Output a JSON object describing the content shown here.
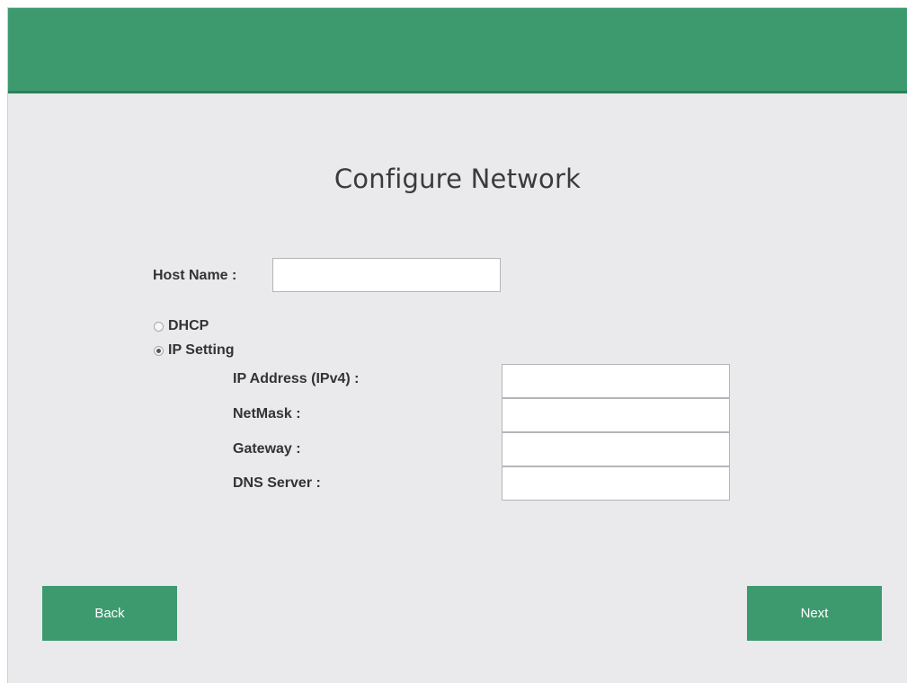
{
  "page": {
    "title": "Configure Network"
  },
  "form": {
    "host_name_label": "Host Name :",
    "host_name_value": "",
    "network_mode": {
      "options": [
        {
          "label": "DHCP",
          "selected": false
        },
        {
          "label": "IP Setting",
          "selected": true
        }
      ]
    },
    "ip_setting": {
      "ip_address_label": "IP Address (IPv4) :",
      "ip_address_value": "",
      "netmask_label": "NetMask :",
      "netmask_value": "",
      "gateway_label": "Gateway :",
      "gateway_value": "",
      "dns_label": "DNS Server :",
      "dns_value": ""
    }
  },
  "footer": {
    "back_label": "Back",
    "next_label": "Next"
  },
  "colors": {
    "accent": "#3d9a6f",
    "background": "#eaeaec"
  }
}
